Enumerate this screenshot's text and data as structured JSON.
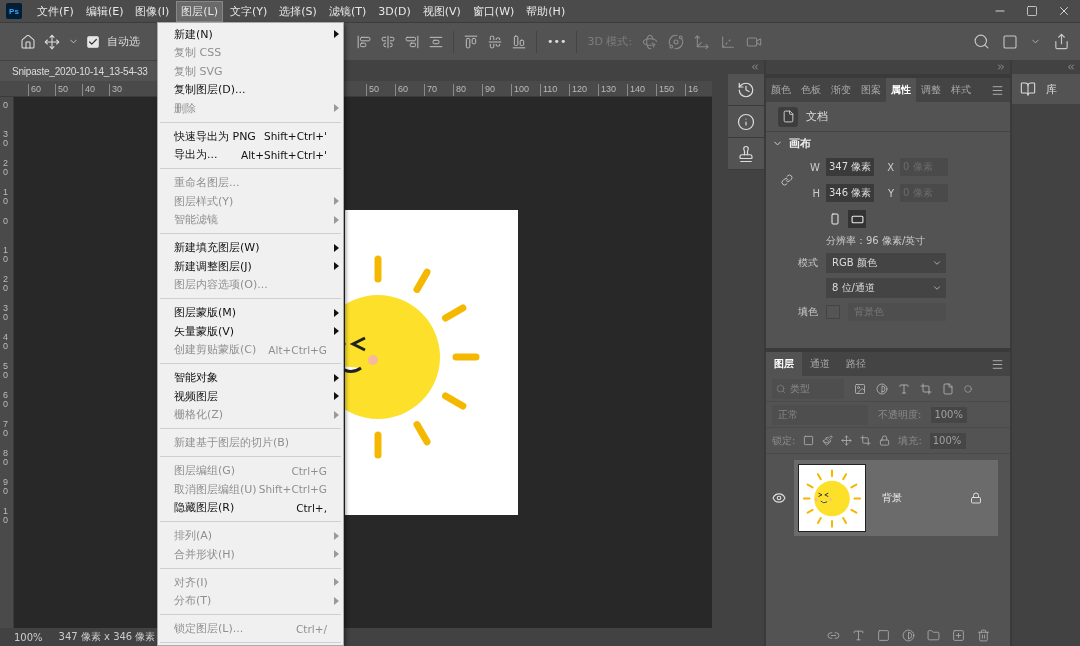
{
  "app_icon": "Ps",
  "menubar": [
    {
      "label": "文件(F)",
      "selected": false
    },
    {
      "label": "编辑(E)",
      "selected": false
    },
    {
      "label": "图像(I)",
      "selected": false
    },
    {
      "label": "图层(L)",
      "selected": true
    },
    {
      "label": "文字(Y)",
      "selected": false
    },
    {
      "label": "选择(S)",
      "selected": false
    },
    {
      "label": "滤镜(T)",
      "selected": false
    },
    {
      "label": "3D(D)",
      "selected": false
    },
    {
      "label": "视图(V)",
      "selected": false
    },
    {
      "label": "窗口(W)",
      "selected": false
    },
    {
      "label": "帮助(H)",
      "selected": false
    }
  ],
  "options_bar": {
    "auto_select": {
      "label": "自动选",
      "checked": true
    },
    "more": "•••",
    "mode_label": "3D 模式:"
  },
  "document_tab": "Snipaste_2020-10-14_13-54-33",
  "ruler": {
    "left_labels": [
      "60",
      "50",
      "40",
      "30"
    ],
    "right_labels": [
      "50",
      "60",
      "70",
      "80",
      "90",
      "100",
      "110",
      "120",
      "130",
      "140",
      "150",
      "16"
    ],
    "vertical_labels": [
      "0",
      "30",
      "20",
      "10",
      "0",
      "10",
      "20",
      "30",
      "40",
      "50",
      "60",
      "70",
      "80",
      "90",
      "10"
    ]
  },
  "status_bar": {
    "zoom": "100%",
    "size": "347 像素 x 346 像素"
  },
  "layer_menu": {
    "groups": [
      [
        {
          "label": "新建(N)",
          "disabled": false,
          "submenu": true
        },
        {
          "label": "复制 CSS",
          "disabled": true,
          "submenu": false
        },
        {
          "label": "复制 SVG",
          "disabled": true,
          "submenu": false
        },
        {
          "label": "复制图层(D)...",
          "disabled": false,
          "submenu": false
        },
        {
          "label": "删除",
          "disabled": true,
          "submenu": true
        }
      ],
      [
        {
          "label": "快速导出为 PNG",
          "shortcut": "Shift+Ctrl+'",
          "disabled": false,
          "submenu": false
        },
        {
          "label": "导出为...",
          "shortcut": "Alt+Shift+Ctrl+'",
          "disabled": false,
          "submenu": false
        }
      ],
      [
        {
          "label": "重命名图层...",
          "disabled": true,
          "submenu": false
        },
        {
          "label": "图层样式(Y)",
          "disabled": true,
          "submenu": true
        },
        {
          "label": "智能滤镜",
          "disabled": true,
          "submenu": true
        }
      ],
      [
        {
          "label": "新建填充图层(W)",
          "disabled": false,
          "submenu": true
        },
        {
          "label": "新建调整图层(J)",
          "disabled": false,
          "submenu": true
        },
        {
          "label": "图层内容选项(O)...",
          "disabled": true,
          "submenu": false
        }
      ],
      [
        {
          "label": "图层蒙版(M)",
          "disabled": false,
          "submenu": true
        },
        {
          "label": "矢量蒙版(V)",
          "disabled": false,
          "submenu": true
        },
        {
          "label": "创建剪贴蒙版(C)",
          "shortcut": "Alt+Ctrl+G",
          "disabled": true,
          "submenu": false
        }
      ],
      [
        {
          "label": "智能对象",
          "disabled": false,
          "submenu": true
        },
        {
          "label": "视频图层",
          "disabled": false,
          "submenu": true
        },
        {
          "label": "栅格化(Z)",
          "disabled": true,
          "submenu": true
        }
      ],
      [
        {
          "label": "新建基于图层的切片(B)",
          "disabled": true,
          "submenu": false
        }
      ],
      [
        {
          "label": "图层编组(G)",
          "shortcut": "Ctrl+G",
          "disabled": true,
          "submenu": false
        },
        {
          "label": "取消图层编组(U)",
          "shortcut": "Shift+Ctrl+G",
          "disabled": true,
          "submenu": false
        },
        {
          "label": "隐藏图层(R)",
          "shortcut": "Ctrl+,",
          "disabled": false,
          "submenu": false
        }
      ],
      [
        {
          "label": "排列(A)",
          "disabled": true,
          "submenu": true
        },
        {
          "label": "合并形状(H)",
          "disabled": true,
          "submenu": true
        }
      ],
      [
        {
          "label": "对齐(I)",
          "disabled": true,
          "submenu": true
        },
        {
          "label": "分布(T)",
          "disabled": true,
          "submenu": true
        }
      ],
      [
        {
          "label": "锁定图层(L)...",
          "shortcut": "Ctrl+/",
          "disabled": true,
          "submenu": false
        }
      ]
    ]
  },
  "properties": {
    "tabs": [
      {
        "label": "颜色",
        "selected": false
      },
      {
        "label": "色板",
        "selected": false
      },
      {
        "label": "渐变",
        "selected": false
      },
      {
        "label": "图案",
        "selected": false
      },
      {
        "label": "属性",
        "selected": true
      },
      {
        "label": "调整",
        "selected": false
      },
      {
        "label": "样式",
        "selected": false
      }
    ],
    "document_label": "文档",
    "section": {
      "title": "画布",
      "expanded": true
    },
    "size_fields": [
      {
        "label": "W",
        "value": "347 像素",
        "disabled": false
      },
      {
        "label": "X",
        "value": "0 像素",
        "disabled": true
      },
      {
        "label": "H",
        "value": "346 像素",
        "disabled": false
      },
      {
        "label": "Y",
        "value": "0 像素",
        "disabled": true
      }
    ],
    "orientation": [
      {
        "kind": "portrait",
        "selected": false
      },
      {
        "kind": "landscape",
        "selected": true
      }
    ],
    "resolution": "分辨率：96 像素/英寸",
    "mode_label": "模式",
    "mode": "RGB 颜色",
    "depth": "8 位/通道",
    "fill_label": "填色",
    "fill": "背景色"
  },
  "layers": {
    "tabs": [
      {
        "label": "图层",
        "selected": true
      },
      {
        "label": "通道",
        "selected": false
      },
      {
        "label": "路径",
        "selected": false
      }
    ],
    "filter_placeholder": "类型",
    "blend_mode": "正常",
    "opacity_label": "不透明度:",
    "opacity": "100%",
    "lock_label": "锁定:",
    "fill_label": "填充:",
    "fill": "100%",
    "controls_disabled": true,
    "items": [
      {
        "name": "背景",
        "visible": true,
        "locked": true,
        "selected": true
      }
    ]
  },
  "library": {
    "label": "库"
  }
}
